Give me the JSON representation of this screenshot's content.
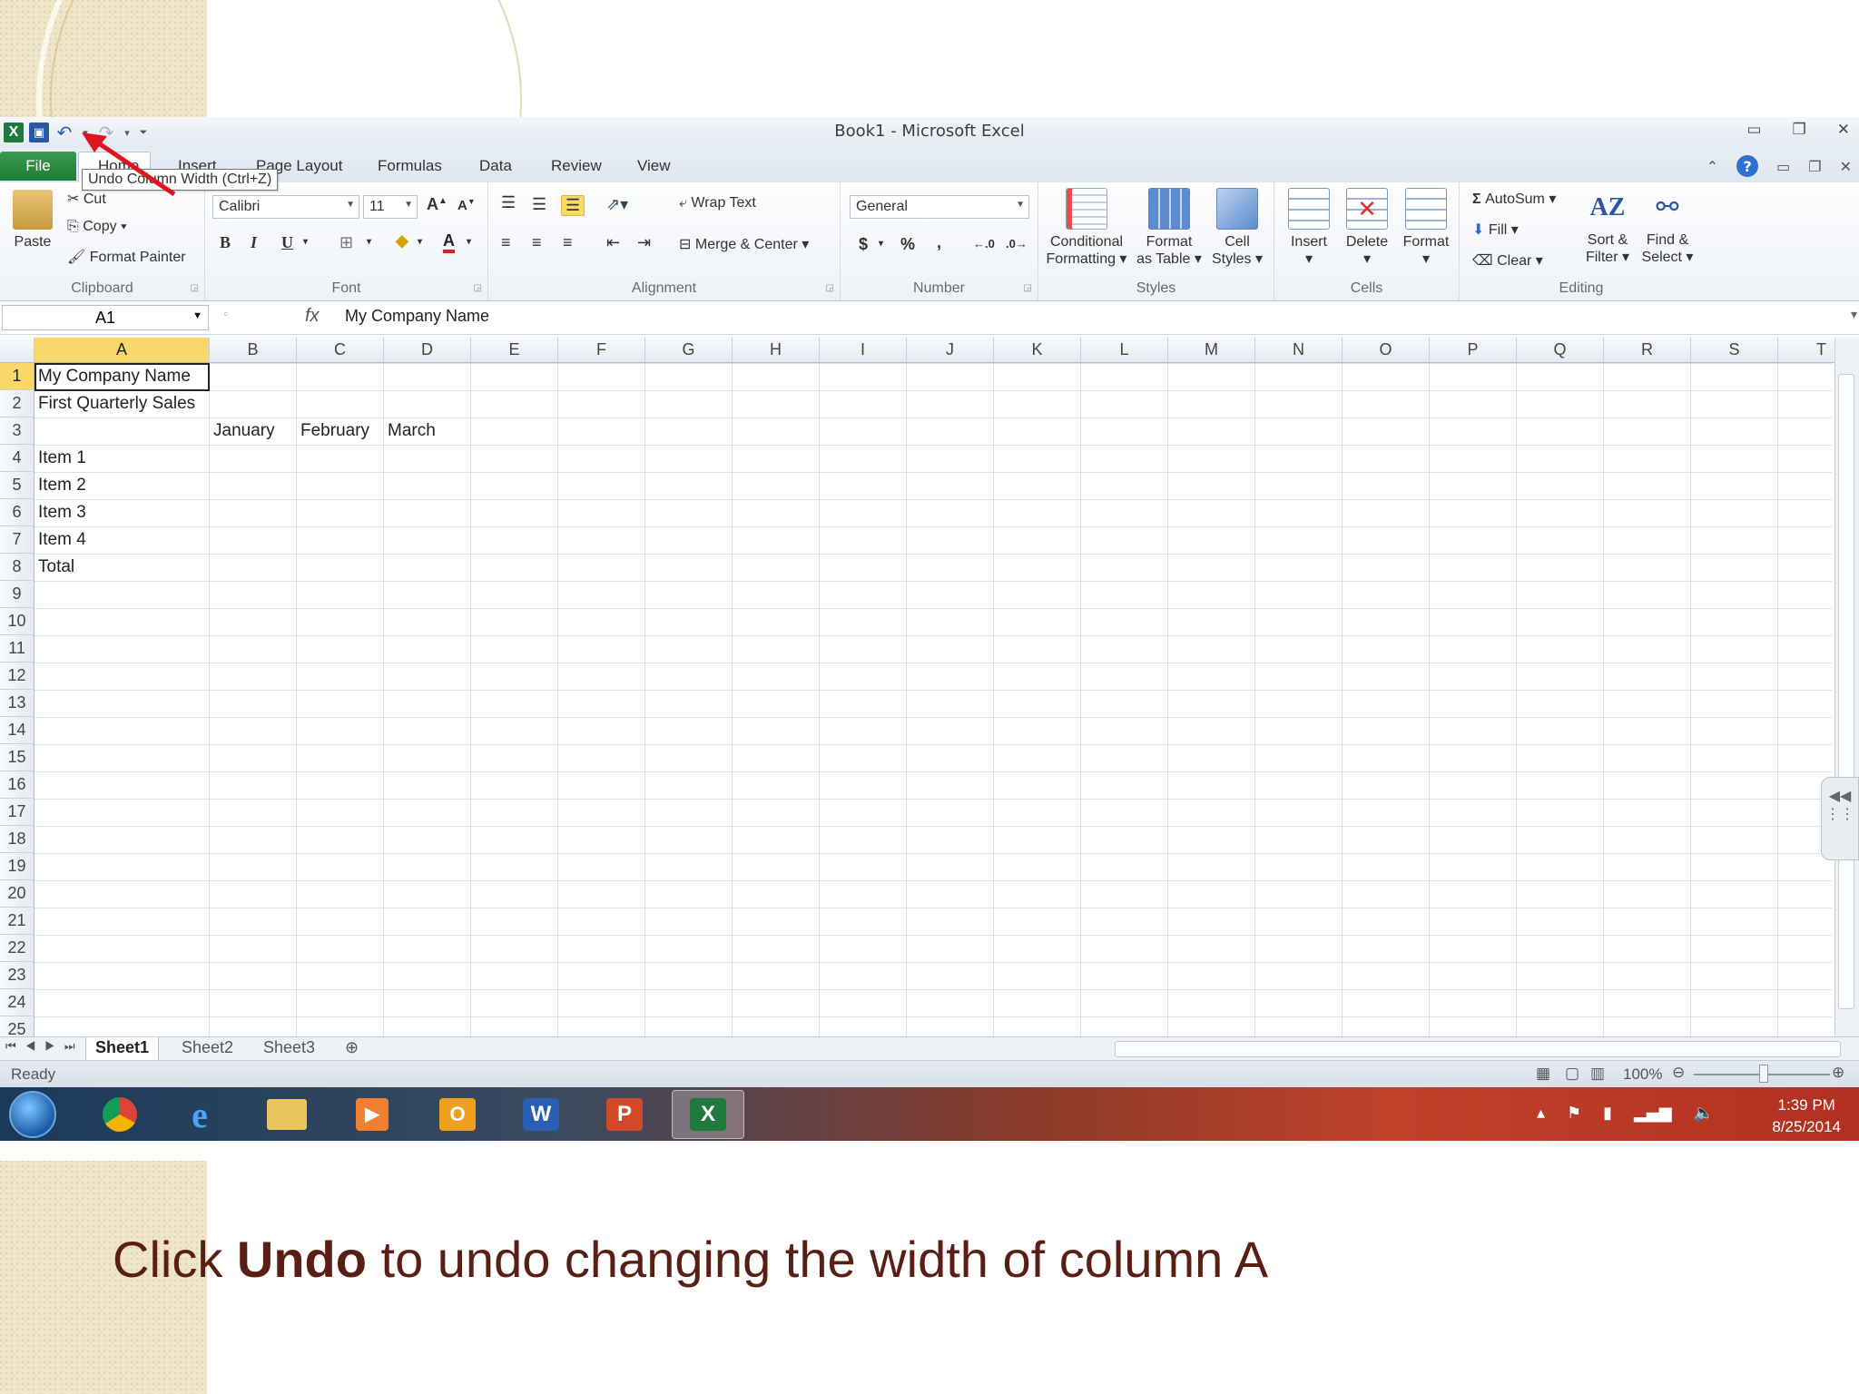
{
  "window": {
    "title": "Book1  -  Microsoft Excel"
  },
  "qat": {
    "icons": [
      "excel-logo-icon",
      "save-icon",
      "undo-icon",
      "redo-icon",
      "customize-qat-icon"
    ]
  },
  "tabs": {
    "file": "File",
    "home": "Home",
    "insert": "Insert",
    "page_layout": "Page Layout",
    "formulas": "Formulas",
    "data": "Data",
    "review": "Review",
    "view": "View"
  },
  "tooltip": {
    "text": "Undo Column Width (Ctrl+Z)"
  },
  "ribbon": {
    "clipboard": {
      "paste": "Paste",
      "cut": "Cut",
      "copy": "Copy",
      "format_painter": "Format Painter",
      "label": "Clipboard"
    },
    "font": {
      "name": "Calibri",
      "size": "11",
      "bold": "B",
      "italic": "I",
      "underline": "U",
      "font_color": "A",
      "label": "Font"
    },
    "alignment": {
      "wrap_text": "Wrap Text",
      "merge_center": "Merge & Center",
      "label": "Alignment"
    },
    "number": {
      "format": "General",
      "currency": "$",
      "percent": "%",
      "comma": ",",
      "label": "Number"
    },
    "styles": {
      "conditional": [
        "Conditional",
        "Formatting"
      ],
      "format_table": [
        "Format",
        "as Table"
      ],
      "cell_styles": [
        "Cell",
        "Styles"
      ],
      "label": "Styles"
    },
    "cells": {
      "insert": "Insert",
      "delete": "Delete",
      "format": "Format",
      "label": "Cells"
    },
    "editing": {
      "autosum": "AutoSum",
      "fill": "Fill",
      "clear": "Clear",
      "sort_filter": [
        "Sort &",
        "Filter"
      ],
      "find_select": [
        "Find &",
        "Select"
      ],
      "label": "Editing"
    }
  },
  "formula_bar": {
    "name_box": "A1",
    "fx": "fx",
    "content": "My Company Name"
  },
  "grid": {
    "columns": [
      "A",
      "B",
      "C",
      "D",
      "E",
      "F",
      "G",
      "H",
      "I",
      "J",
      "K",
      "L",
      "M",
      "N",
      "O",
      "P",
      "Q",
      "R",
      "S",
      "T"
    ],
    "rows": [
      "1",
      "2",
      "3",
      "4",
      "5",
      "6",
      "7",
      "8",
      "9",
      "10",
      "11",
      "12",
      "13",
      "14",
      "15",
      "16",
      "17",
      "18",
      "19",
      "20",
      "21",
      "22",
      "23",
      "24",
      "25"
    ],
    "selected_column": "A",
    "selected_row": "1",
    "cells": {
      "A1": "My Company Name",
      "A2": "First Quarterly Sales",
      "B3": "January",
      "C3": "February",
      "D3": "March",
      "A4": "Item 1",
      "A5": "Item 2",
      "A6": "Item 3",
      "A7": "Item 4",
      "A8": "Total"
    }
  },
  "sheets": {
    "tabs": [
      "Sheet1",
      "Sheet2",
      "Sheet3"
    ],
    "active": "Sheet1"
  },
  "status": {
    "ready": "Ready",
    "zoom": "100%"
  },
  "taskbar": {
    "time": "1:39 PM",
    "date": "8/25/2014",
    "apps": [
      "chrome-icon",
      "internet-explorer-icon",
      "file-explorer-icon",
      "media-player-icon",
      "outlook-icon",
      "word-icon",
      "powerpoint-icon",
      "excel-icon"
    ]
  },
  "caption": {
    "pre": "Click ",
    "bold": "Undo",
    "post": " to undo changing the width of column A"
  },
  "colors": {
    "accent_green": "#1e7a3c",
    "selection_yellow": "#f9d76b",
    "caption_brown": "#5a1f14",
    "arrow_red": "#e0141e"
  }
}
